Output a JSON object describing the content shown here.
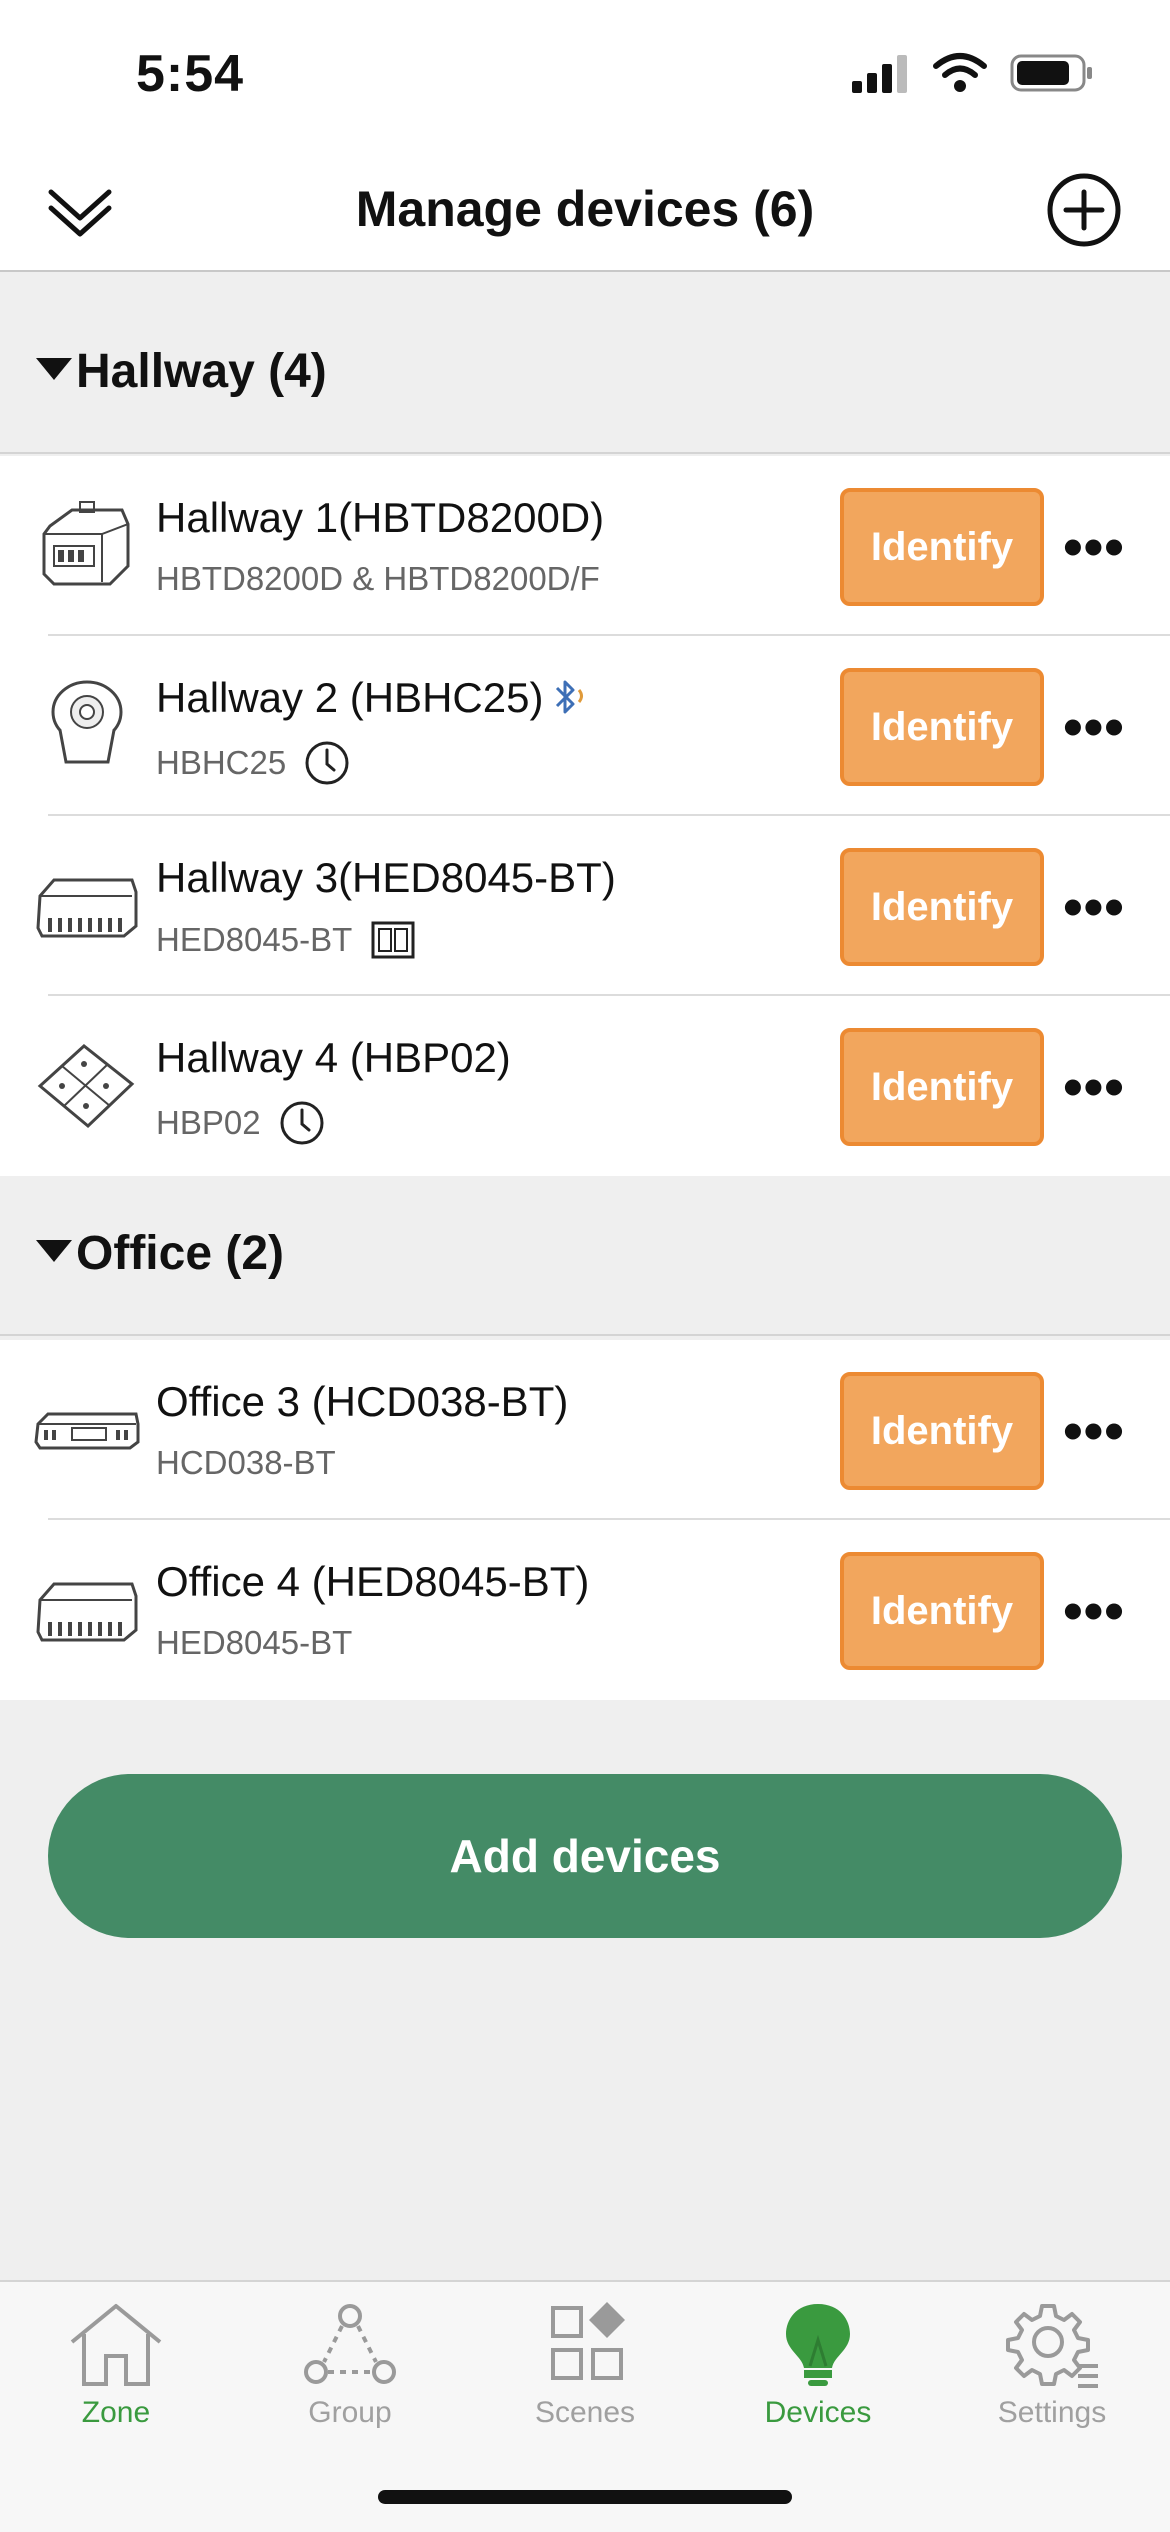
{
  "status_bar": {
    "time": "5:54"
  },
  "nav": {
    "title": "Manage devices (6)"
  },
  "sections": [
    {
      "title": "Hallway (4)",
      "devices": [
        {
          "name": "Hallway 1(HBTD8200D)",
          "model": "HBTD8200D & HBTD8200D/F",
          "badge": "",
          "bluetooth": false
        },
        {
          "name": "Hallway 2 (HBHC25)",
          "model": "HBHC25",
          "badge": "clock-icon",
          "bluetooth": true
        },
        {
          "name": "Hallway 3(HED8045-BT)",
          "model": "HED8045-BT",
          "badge": "panel-icon",
          "bluetooth": false
        },
        {
          "name": "Hallway 4 (HBP02)",
          "model": "HBP02",
          "badge": "clock-icon",
          "bluetooth": false
        }
      ]
    },
    {
      "title": "Office (2)",
      "devices": [
        {
          "name": "Office 3 (HCD038-BT)",
          "model": "HCD038-BT",
          "badge": "",
          "bluetooth": false
        },
        {
          "name": "Office 4 (HED8045-BT)",
          "model": "HED8045-BT",
          "badge": "",
          "bluetooth": false
        }
      ]
    }
  ],
  "buttons": {
    "identify": "Identify",
    "more": "•••",
    "add_devices": "Add devices"
  },
  "tabs": [
    {
      "label": "Zone",
      "icon": "home-icon",
      "active": true
    },
    {
      "label": "Group",
      "icon": "group-icon",
      "active": false
    },
    {
      "label": "Scenes",
      "icon": "scenes-icon",
      "active": false
    },
    {
      "label": "Devices",
      "icon": "bulb-icon",
      "active": true
    },
    {
      "label": "Settings",
      "icon": "gear-icon",
      "active": false
    }
  ],
  "colors": {
    "identify_fill": "#f2a65d",
    "identify_border": "#ec8a32",
    "add_button": "#448b66",
    "active_tab": "#3a9a3f"
  }
}
